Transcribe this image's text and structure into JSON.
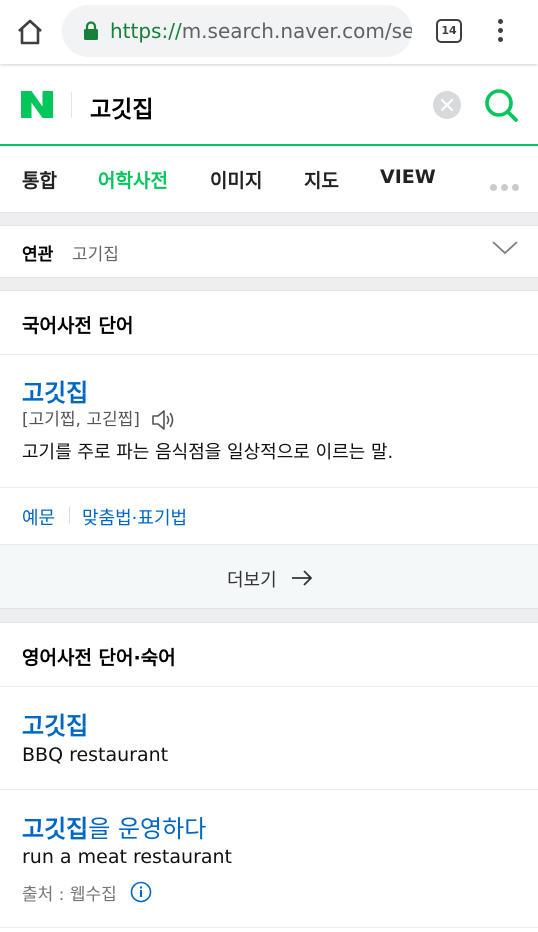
{
  "browser": {
    "url_scheme": "https://",
    "url_rest": "m.search.naver.com/se",
    "tab_count": "14"
  },
  "search": {
    "query": "고깃집"
  },
  "tabs": [
    {
      "label": "통합"
    },
    {
      "label": "어학사전"
    },
    {
      "label": "이미지"
    },
    {
      "label": "지도"
    },
    {
      "label": "VIEW"
    }
  ],
  "related": {
    "label": "연관",
    "term": "고기집"
  },
  "korean_dict": {
    "title": "국어사전 단어",
    "word": "고깃집",
    "pronunciation": "[고기찝, 고긷찝]",
    "definition": "고기를 주로 파는 음식점을 일상적으로 이르는 말.",
    "link_examples": "예문",
    "link_spelling": "맞춤법·표기법",
    "more_label": "더보기"
  },
  "english_dict": {
    "title": "영어사전 단어·숙어",
    "entry1_word": "고깃집",
    "entry1_meaning": "BBQ restaurant",
    "entry2_word_bold": "고깃집",
    "entry2_word_rest": "을 운영하다",
    "entry2_meaning": "run a meat restaurant",
    "source": "출처 : 웹수집"
  },
  "colors": {
    "naver_green": "#03c75a",
    "link_blue": "#0068c3"
  }
}
